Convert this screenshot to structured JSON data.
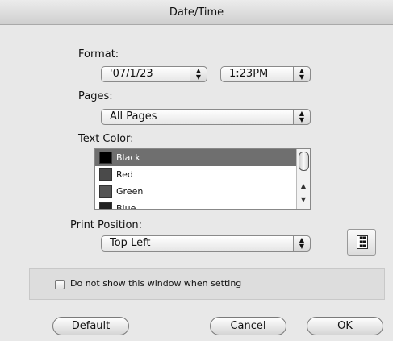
{
  "window": {
    "title": "Date/Time"
  },
  "format": {
    "label": "Format:",
    "date_value": "'07/1/23",
    "time_value": "1:23PM"
  },
  "pages": {
    "label": "Pages:",
    "value": "All Pages"
  },
  "text_color": {
    "label": "Text Color:",
    "items": [
      {
        "label": "Black",
        "color": "#000000",
        "selected": true
      },
      {
        "label": "Red",
        "color": "#4a4a4a",
        "selected": false
      },
      {
        "label": "Green",
        "color": "#555555",
        "selected": false
      },
      {
        "label": "Blue",
        "color": "#222222",
        "selected": false
      }
    ]
  },
  "print_position": {
    "label": "Print Position:",
    "value": "Top Left",
    "icon": "page-position-icon"
  },
  "options": {
    "checkbox_label": "Do not show this window when setting",
    "checked": false
  },
  "buttons": {
    "default_label": "Default",
    "cancel_label": "Cancel",
    "ok_label": "OK"
  }
}
